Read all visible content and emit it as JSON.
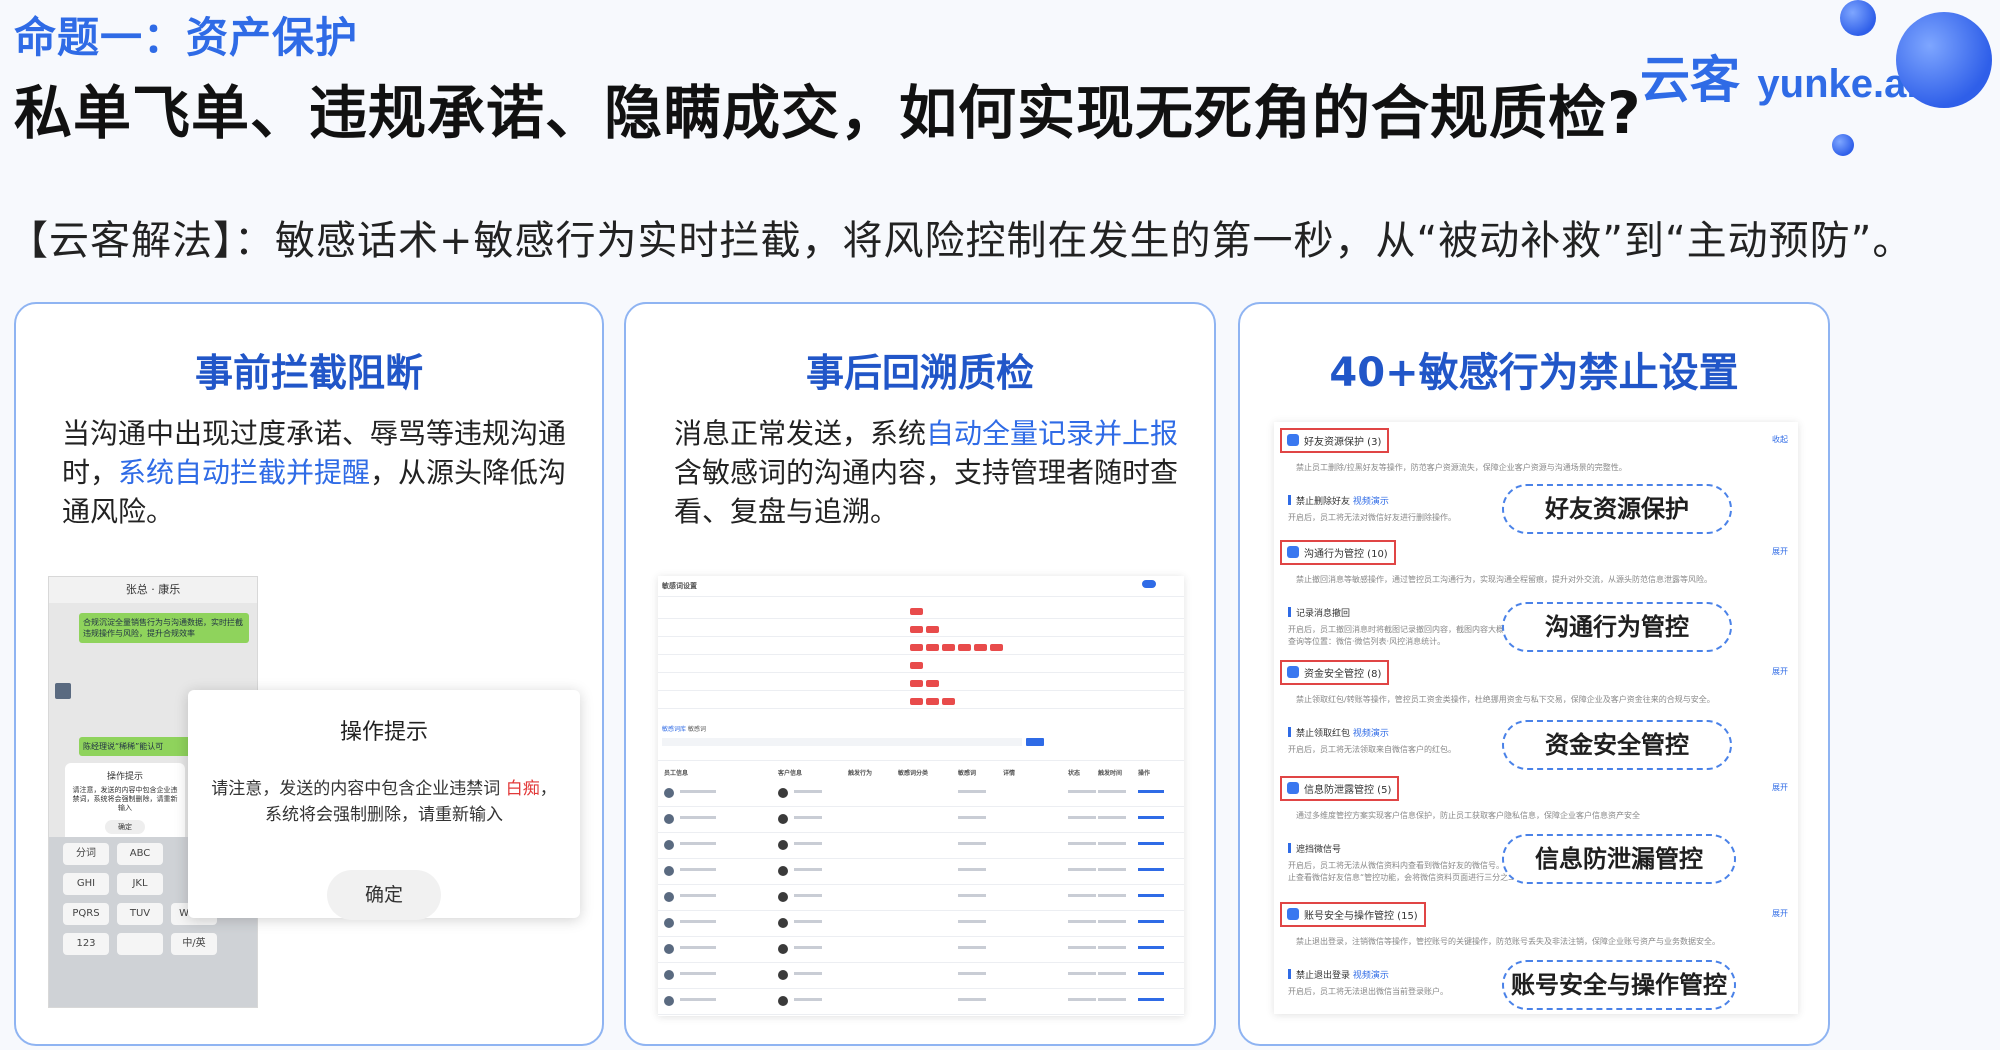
{
  "header": {
    "topic": "命题一：资产保护",
    "title": "私单飞单、违规承诺、隐瞒成交，如何实现无死角的合规质检?",
    "logo_cn": "云客",
    "logo_en": "yunke.ai",
    "solution": "【云客解法】：敏感话术+敏感行为实时拦截，将风险控制在发生的第一秒，从“被动补救”到“主动预防”。"
  },
  "cards": [
    {
      "title": "事前拦截阻断",
      "desc_1": "当沟通中出现过度承诺、辱骂等违规沟通时，",
      "desc_hl": "系统自动拦截并提醒",
      "desc_2": "，从源头降低沟通风险。"
    },
    {
      "title": "事后回溯质检",
      "desc_1": "消息正常发送，系统",
      "desc_hl": "自动全量记录并上报",
      "desc_2": "含敏感词的沟通内容，支持管理者随时查看、复盘与追溯。"
    },
    {
      "title": "40+敏感行为禁止设置"
    }
  ],
  "phone": {
    "header": "张总 · 康乐",
    "bubble_1": "合规沉淀全量销售行为与沟通数据，实时拦截违规操作与风险，提升合规效率",
    "bubble_2": "陈经理说“稀稀”能认可",
    "small_title": "操作提示",
    "small_msg": "请注意，发送的内容中包含企业违禁词，系统将会强制删除，请重新输入",
    "small_btn": "确定",
    "keys": [
      "分词",
      "ABC",
      "GHI",
      "JKL",
      "PQRS",
      "TUV",
      "WXYZ",
      "123",
      "中/英"
    ]
  },
  "dialog": {
    "title": "操作提示",
    "msg_1": "请注意，发送的内容中包含企业违禁词 ",
    "msg_red": "白痴",
    "msg_2": "，",
    "msg_3": "系统将会强制删除，请重新输入",
    "button": "确定"
  },
  "table_mock": {
    "title": "敏感词设置",
    "tabs": [
      "敏感词库",
      "敏感词"
    ],
    "columns": [
      "员工信息",
      "客户信息",
      "触发行为",
      "敏感词分类",
      "敏感词",
      "详情",
      "状态",
      "触发时间",
      "操作"
    ]
  },
  "settings": {
    "collapse": "收起",
    "expand": "展开",
    "video": "视频演示",
    "sections": [
      {
        "title": "好友资源保护 (3)",
        "sub": "禁止员工删除/拉黑好友等操作，防范客户资源流失，保障企业客户资源与沟通场景的完整性。",
        "item": "禁止删除好友",
        "item_sub": "开启后，员工将无法对微信好友进行删除操作。",
        "pill": "好友资源保护",
        "toggle": "收起"
      },
      {
        "title": "沟通行为管控 (10)",
        "sub": "禁止撤回消息等敏感操作，通过管控员工沟通行为，实现沟通全程留痕，提升对外交流，从源头防范信息泄露等风险。",
        "item": "记录消息撤回",
        "item_sub": "开启后，员工撤回消息时将截图记录撤回内容，截图内容大概率会出现只能到被撤回中方式处理回的页面截图。",
        "item_sub_2": "查询等位置：微信·微信列表·风控消息统计。",
        "pill": "沟通行为管控",
        "toggle": "展开"
      },
      {
        "title": "资金安全管控 (8)",
        "sub": "禁止领取红包/转账等操作，管控员工资金类操作，杜绝挪用资金与私下交易，保障企业及客户资金往来的合规与安全。",
        "item": "禁止领取红包",
        "item_sub": "开启后，员工将无法领取来自微信客户的红包。",
        "pill": "资金安全管控",
        "toggle": "展开"
      },
      {
        "title": "信息防泄露管控 (5)",
        "sub": "通过多维度管控方案实现客户信息保护，防止员工获取客户隐私信息，保障企业客户信息资产安全",
        "item": "遮挡微信号",
        "item_sub": "开启后，员工将无法从微信资料内查看到微信好友的微信号。采用的是屏幕遮挡的方式实现的，外观屏幕在快速",
        "item_sub_2": "止查看微信好友信息“管控功能，会将微信资料页面进行三分之二屏幕遮挡，并屏蔽滚动最查看微信号",
        "pill": "信息防泄漏管控",
        "toggle": "展开"
      },
      {
        "title": "账号安全与操作管控 (15)",
        "sub": "禁止退出登录，注销微信等操作，管控账号的关键操作，防范账号丢失及非法注销，保障企业账号资产与业务数据安全。",
        "item": "禁止退出登录",
        "item_sub": "开启后，员工将无法退出微信当前登录账户。",
        "pill": "账号安全与操作管控",
        "toggle": "展开"
      }
    ]
  },
  "colors": {
    "accent": "#2f6be6",
    "title_blue": "#2156c8",
    "danger": "#e23a3a",
    "card_border": "#8fb4f2"
  }
}
